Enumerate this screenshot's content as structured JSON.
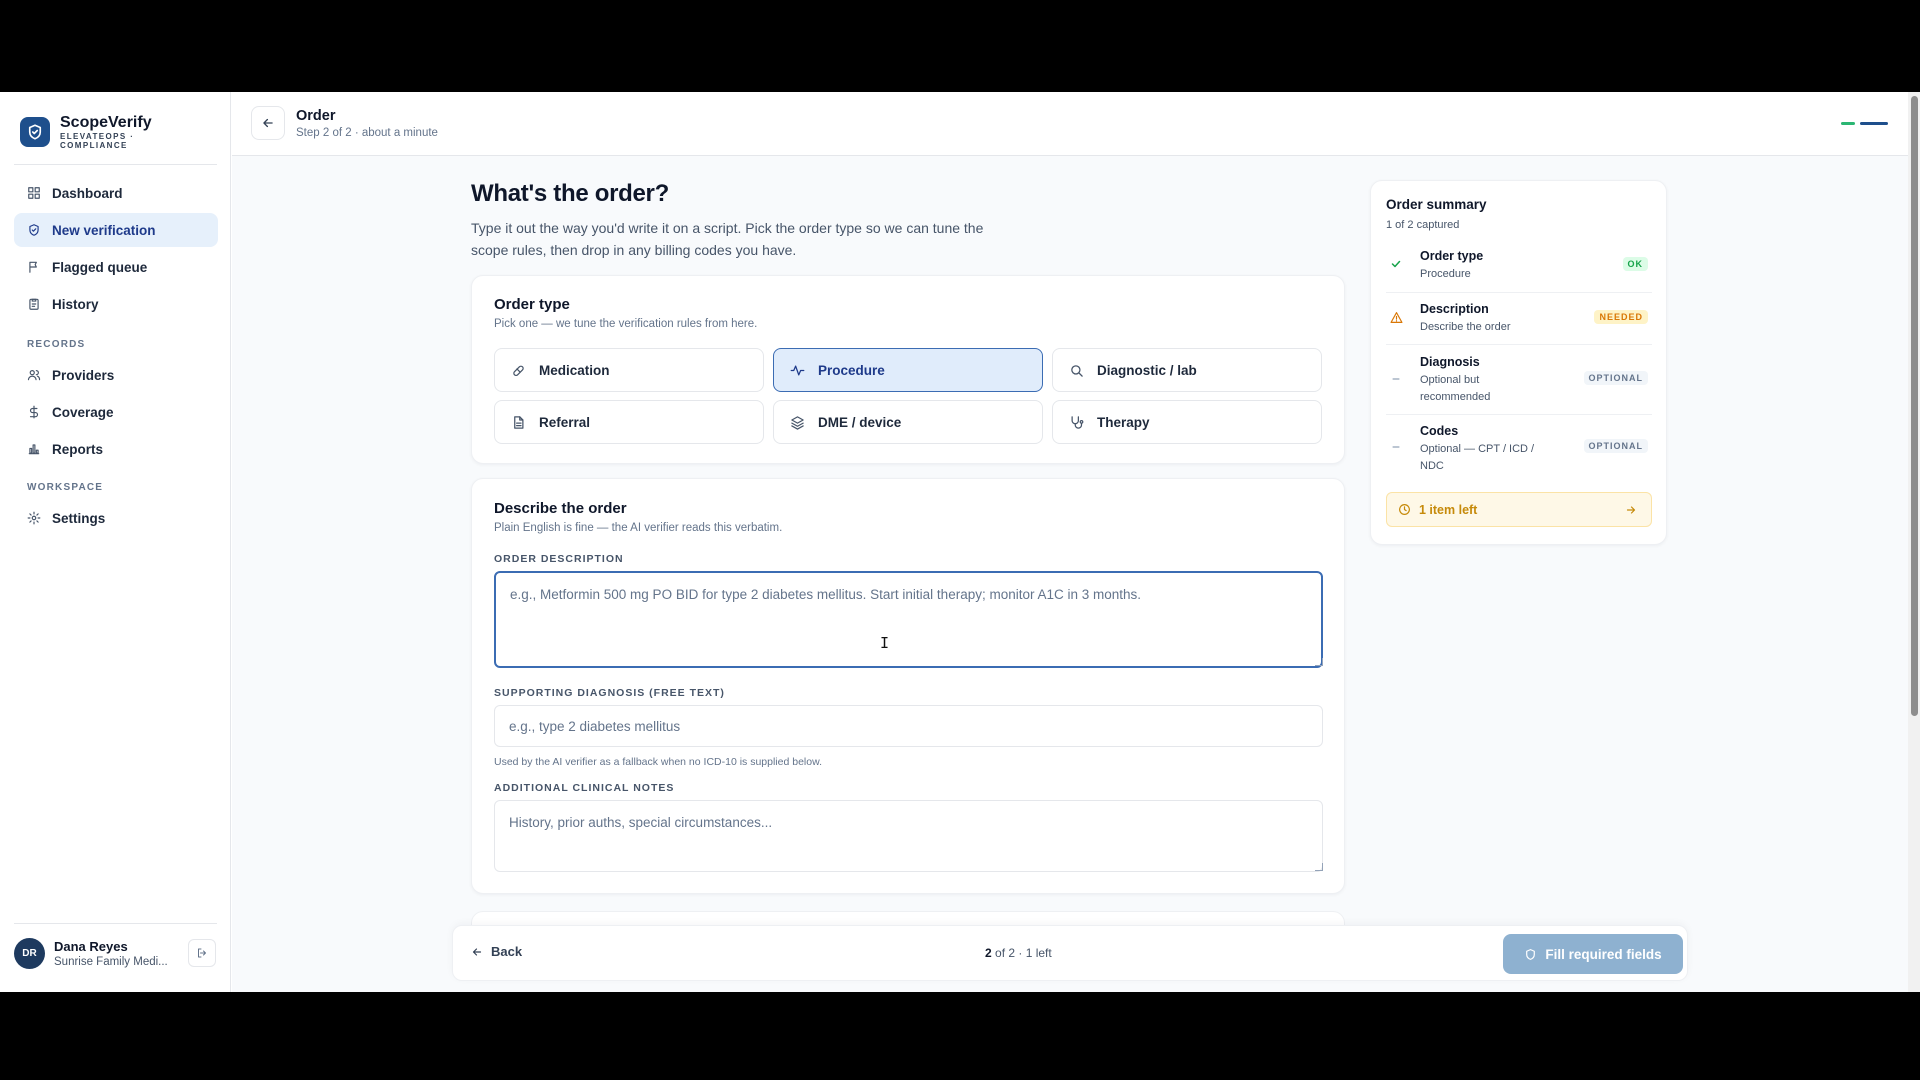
{
  "brand": {
    "name": "ScopeVerify",
    "sub": "ELEVATEOPS · COMPLIANCE"
  },
  "sidebar": {
    "items": [
      {
        "label": "Dashboard",
        "icon": "grid-icon"
      },
      {
        "label": "New verification",
        "icon": "shield-check-icon",
        "active": true
      },
      {
        "label": "Flagged queue",
        "icon": "flag-icon"
      },
      {
        "label": "History",
        "icon": "clipboard-icon"
      }
    ],
    "records_label": "RECORDS",
    "records": [
      {
        "label": "Providers",
        "icon": "users-icon"
      },
      {
        "label": "Coverage",
        "icon": "dollar-icon"
      },
      {
        "label": "Reports",
        "icon": "bar-chart-icon"
      }
    ],
    "workspace_label": "WORKSPACE",
    "workspace": [
      {
        "label": "Settings",
        "icon": "gear-icon"
      }
    ]
  },
  "user": {
    "initials": "DR",
    "name": "Dana Reyes",
    "org": "Sunrise Family Medi..."
  },
  "header": {
    "title": "Order",
    "subtitle": "Step 2 of 2 · about a minute"
  },
  "page": {
    "title": "What's the order?",
    "description": "Type it out the way you'd write it on a script. Pick the order type so we can tune the scope rules, then drop in any billing codes you have."
  },
  "order_type": {
    "title": "Order type",
    "subtitle": "Pick one — we tune the verification rules from here.",
    "options": [
      {
        "label": "Medication",
        "icon": "pill-icon"
      },
      {
        "label": "Procedure",
        "icon": "pulse-icon",
        "selected": true
      },
      {
        "label": "Diagnostic / lab",
        "icon": "search-icon"
      },
      {
        "label": "Referral",
        "icon": "document-icon"
      },
      {
        "label": "DME / device",
        "icon": "layers-icon"
      },
      {
        "label": "Therapy",
        "icon": "stethoscope-icon"
      }
    ]
  },
  "describe": {
    "title": "Describe the order",
    "subtitle": "Plain English is fine — the AI verifier reads this verbatim.",
    "order_description_label": "ORDER DESCRIPTION",
    "order_description_placeholder": "e.g., Metformin 500 mg PO BID for type 2 diabetes mellitus. Start initial therapy; monitor A1C in 3 months.",
    "diagnosis_label": "SUPPORTING DIAGNOSIS (FREE TEXT)",
    "diagnosis_placeholder": "e.g., type 2 diabetes mellitus",
    "diagnosis_help": "Used by the AI verifier as a fallback when no ICD-10 is supplied below.",
    "notes_label": "ADDITIONAL CLINICAL NOTES",
    "notes_placeholder": "History, prior auths, special circumstances..."
  },
  "summary": {
    "title": "Order summary",
    "subtitle": "1 of 2 captured",
    "rows": [
      {
        "label": "Order type",
        "value": "Procedure",
        "badge": "OK",
        "status": "ok"
      },
      {
        "label": "Description",
        "value": "Describe the order",
        "badge": "NEEDED",
        "status": "needed"
      },
      {
        "label": "Diagnosis",
        "value": "Optional but recommended",
        "badge": "OPTIONAL",
        "status": "optional"
      },
      {
        "label": "Codes",
        "value": "Optional — CPT / ICD / NDC",
        "badge": "OPTIONAL",
        "status": "optional"
      }
    ],
    "items_left": "1 item left"
  },
  "footer": {
    "back_label": "Back",
    "step_current": "2",
    "step_rest": "of 2 · 1 left",
    "submit_label": "Fill required fields"
  },
  "colors": {
    "brand": "#1e4f8c",
    "active_bg": "#e6f0fb",
    "ok": "#16a34a",
    "needed": "#d97706",
    "progress_done": "#2bb673",
    "progress_current": "#1e4f8c",
    "submit_disabled": "#8eb1d0"
  }
}
